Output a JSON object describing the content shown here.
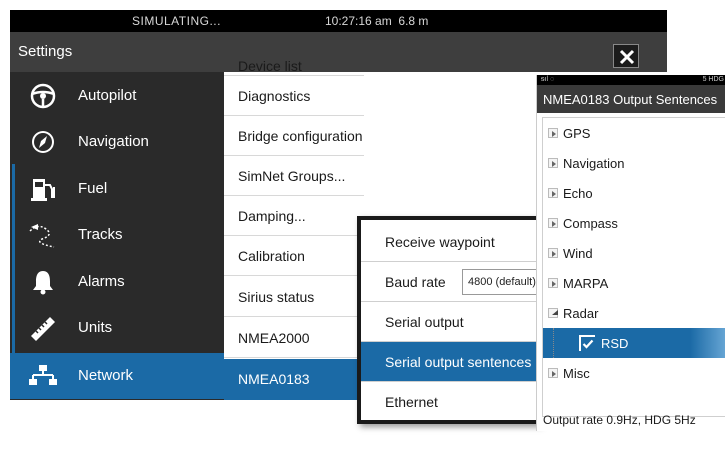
{
  "status": {
    "simulating": "SIMULATING...",
    "time": "10:27:16 am",
    "depth": "6.8 m"
  },
  "titlebar": {
    "title": "Settings"
  },
  "sidebar": {
    "items": [
      {
        "label": "Autopilot",
        "icon": "steering-wheel-icon"
      },
      {
        "label": "Navigation",
        "icon": "compass-icon"
      },
      {
        "label": "Fuel",
        "icon": "fuel-pump-icon"
      },
      {
        "label": "Tracks",
        "icon": "tracks-icon"
      },
      {
        "label": "Alarms",
        "icon": "bell-icon"
      },
      {
        "label": "Units",
        "icon": "ruler-icon"
      },
      {
        "label": "Network",
        "icon": "network-icon",
        "active": true
      }
    ]
  },
  "network_list": {
    "items": [
      {
        "label": "Device list"
      },
      {
        "label": "Diagnostics"
      },
      {
        "label": "Bridge configuration"
      },
      {
        "label": "SimNet Groups..."
      },
      {
        "label": "Damping..."
      },
      {
        "label": "Calibration"
      },
      {
        "label": "Sirius status"
      },
      {
        "label": "NMEA2000"
      },
      {
        "label": "NMEA0183",
        "active": true
      }
    ]
  },
  "nmea_menu": {
    "items": [
      {
        "label": "Receive waypoint"
      },
      {
        "label": "Baud rate",
        "value": "4800 (default)"
      },
      {
        "label": "Serial output"
      },
      {
        "label": "Serial output sentences",
        "active": true
      },
      {
        "label": "Ethernet"
      }
    ]
  },
  "sentences_dialog": {
    "status_left": "ᵴıl ◌",
    "status_right": "5 HDG",
    "title": "NMEA0183 Output Sentences",
    "items": [
      {
        "label": "GPS",
        "expanded": false
      },
      {
        "label": "Navigation",
        "expanded": false
      },
      {
        "label": "Echo",
        "expanded": false
      },
      {
        "label": "Compass",
        "expanded": false
      },
      {
        "label": "Wind",
        "expanded": false
      },
      {
        "label": "MARPA",
        "expanded": false
      },
      {
        "label": "Radar",
        "expanded": true
      },
      {
        "label": "RSD",
        "checked": true,
        "active": true
      },
      {
        "label": "Misc",
        "expanded": false
      }
    ],
    "footer": "Output rate 0.9Hz, HDG 5Hz"
  },
  "colors": {
    "accent": "#1b6aa6",
    "panel_dark": "#2a2a2a",
    "title_bar": "#3e3e3e"
  }
}
